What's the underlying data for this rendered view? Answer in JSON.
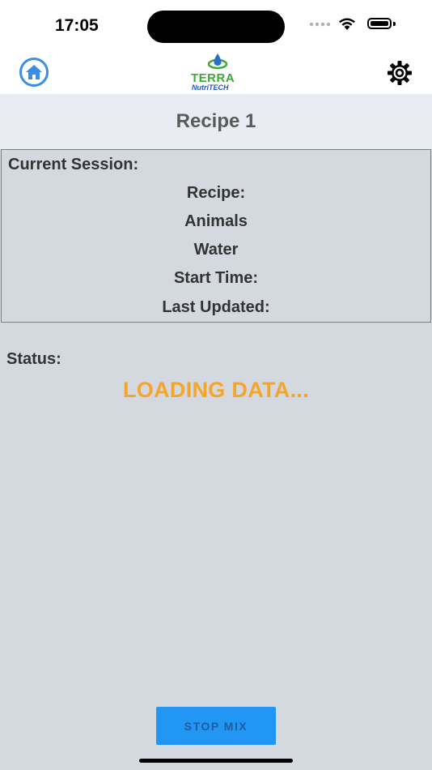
{
  "status_bar": {
    "time": "17:05"
  },
  "nav": {
    "home_icon": "home-icon",
    "settings_icon": "gear-icon",
    "logo_text_primary": "TERRA",
    "logo_text_secondary": "NutriTECH",
    "accent_color": "#3b8ee6"
  },
  "page": {
    "title": "Recipe 1"
  },
  "session": {
    "heading": "Current Session:",
    "recipe_label": "Recipe:",
    "animals_label": "Animals",
    "water_label": "Water",
    "start_time_label": "Start Time:",
    "last_updated_label": "Last Updated:"
  },
  "status": {
    "label": "Status:",
    "value": "LOADING DATA...",
    "value_color": "#f5a62a"
  },
  "actions": {
    "stop_mix_label": "STOP MIX",
    "button_color": "#2196f3"
  }
}
